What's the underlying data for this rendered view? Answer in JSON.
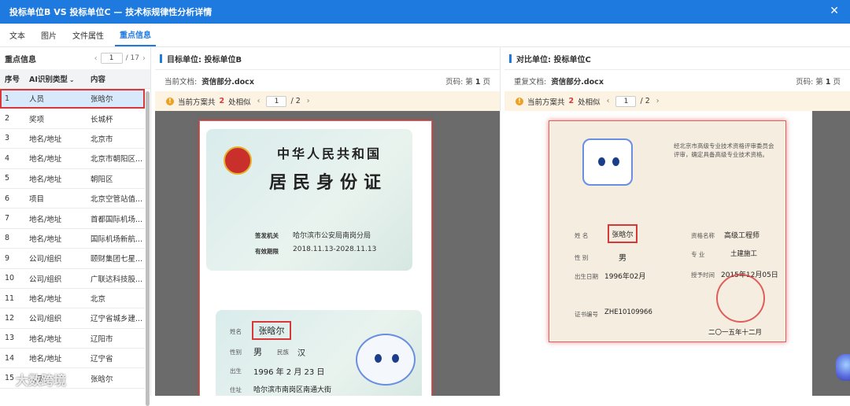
{
  "window": {
    "title": "投标单位B VS 投标单位C — 技术标规律性分析详情",
    "close_icon": "close-icon"
  },
  "tabs": [
    {
      "label": "文本",
      "active": false
    },
    {
      "label": "图片",
      "active": false
    },
    {
      "label": "文件属性",
      "active": false
    },
    {
      "label": "重点信息",
      "active": true
    }
  ],
  "key_info": {
    "title": "重点信息",
    "page_current": "1",
    "page_total": "/ 17",
    "headers": {
      "index": "序号",
      "type": "AI识别类型",
      "content": "内容"
    },
    "rows": [
      {
        "index": "1",
        "type": "人员",
        "content": "张晗尔"
      },
      {
        "index": "2",
        "type": "奖项",
        "content": "长城杯"
      },
      {
        "index": "3",
        "type": "地名/地址",
        "content": "北京市"
      },
      {
        "index": "4",
        "type": "地名/地址",
        "content": "北京市朝阳区..."
      },
      {
        "index": "5",
        "type": "地名/地址",
        "content": "朝阳区"
      },
      {
        "index": "6",
        "type": "项目",
        "content": "北京空管站值..."
      },
      {
        "index": "7",
        "type": "地名/地址",
        "content": "首都国际机场..."
      },
      {
        "index": "8",
        "type": "地名/地址",
        "content": "国际机场新航..."
      },
      {
        "index": "9",
        "type": "公司/组织",
        "content": "颐财集团七星..."
      },
      {
        "index": "10",
        "type": "公司/组织",
        "content": "广联达科技股..."
      },
      {
        "index": "11",
        "type": "地名/地址",
        "content": "北京"
      },
      {
        "index": "12",
        "type": "公司/组织",
        "content": "辽宁省城乡建..."
      },
      {
        "index": "13",
        "type": "地名/地址",
        "content": "辽阳市"
      },
      {
        "index": "14",
        "type": "地名/地址",
        "content": "辽宁省"
      },
      {
        "index": "15",
        "type": "人员",
        "content": "张晗尔"
      }
    ]
  },
  "panel_b": {
    "heading": "目标单位:  投标单位B",
    "doc_label": "当前文档:",
    "doc_name": "资信部分.docx",
    "page_label": "页码:  第",
    "page_num": "1",
    "page_suffix": "页",
    "match_prefix": "当前方案共",
    "match_count": "2",
    "match_suffix": "处相似",
    "match_page": "1",
    "match_total": "/ 2"
  },
  "panel_c": {
    "heading": "对比单位:  投标单位C",
    "doc_label": "重复文档:",
    "doc_name": "资信部分.docx",
    "page_label": "页码:  第",
    "page_num": "1",
    "page_suffix": "页",
    "match_prefix": "当前方案共",
    "match_count": "2",
    "match_suffix": "处相似",
    "match_page": "1",
    "match_total": "/ 2"
  },
  "idcard": {
    "title1": "中华人民共和国",
    "title2": "居民身份证",
    "authority_label": "签发机关",
    "authority": "哈尔滨市公安局南岗分局",
    "valid_label": "有效期限",
    "valid": "2018.11.13-2028.11.13",
    "name_label": "姓名",
    "name": "张晗尔",
    "sex_label": "性别",
    "sex": "男",
    "ethnic_label": "民族",
    "ethnic": "汉",
    "birth_label": "出生",
    "birth": "1996 年 2 月 23 日",
    "address_label": "住址",
    "address": "哈尔滨市南岗区南通大街"
  },
  "certificate": {
    "name_label": "姓  名",
    "name": "张晗尔",
    "sex_label": "性  别",
    "sex": "男",
    "birth_label": "出生日期",
    "birth": "1996年02月",
    "cert_no_label": "证书编号",
    "cert_no": "ZHE10109966",
    "qual_label": "资格名称",
    "qual": "高级工程师",
    "major_label": "专  业",
    "major": "土建施工",
    "date_label": "授予时间",
    "date": "2015年12月05日",
    "issue_date": "二〇一五年十二月",
    "notice": "经北京市高级专业技术资格评审委员会评审，确定具备高级专业技术资格。"
  },
  "watermark": "大数跨境"
}
